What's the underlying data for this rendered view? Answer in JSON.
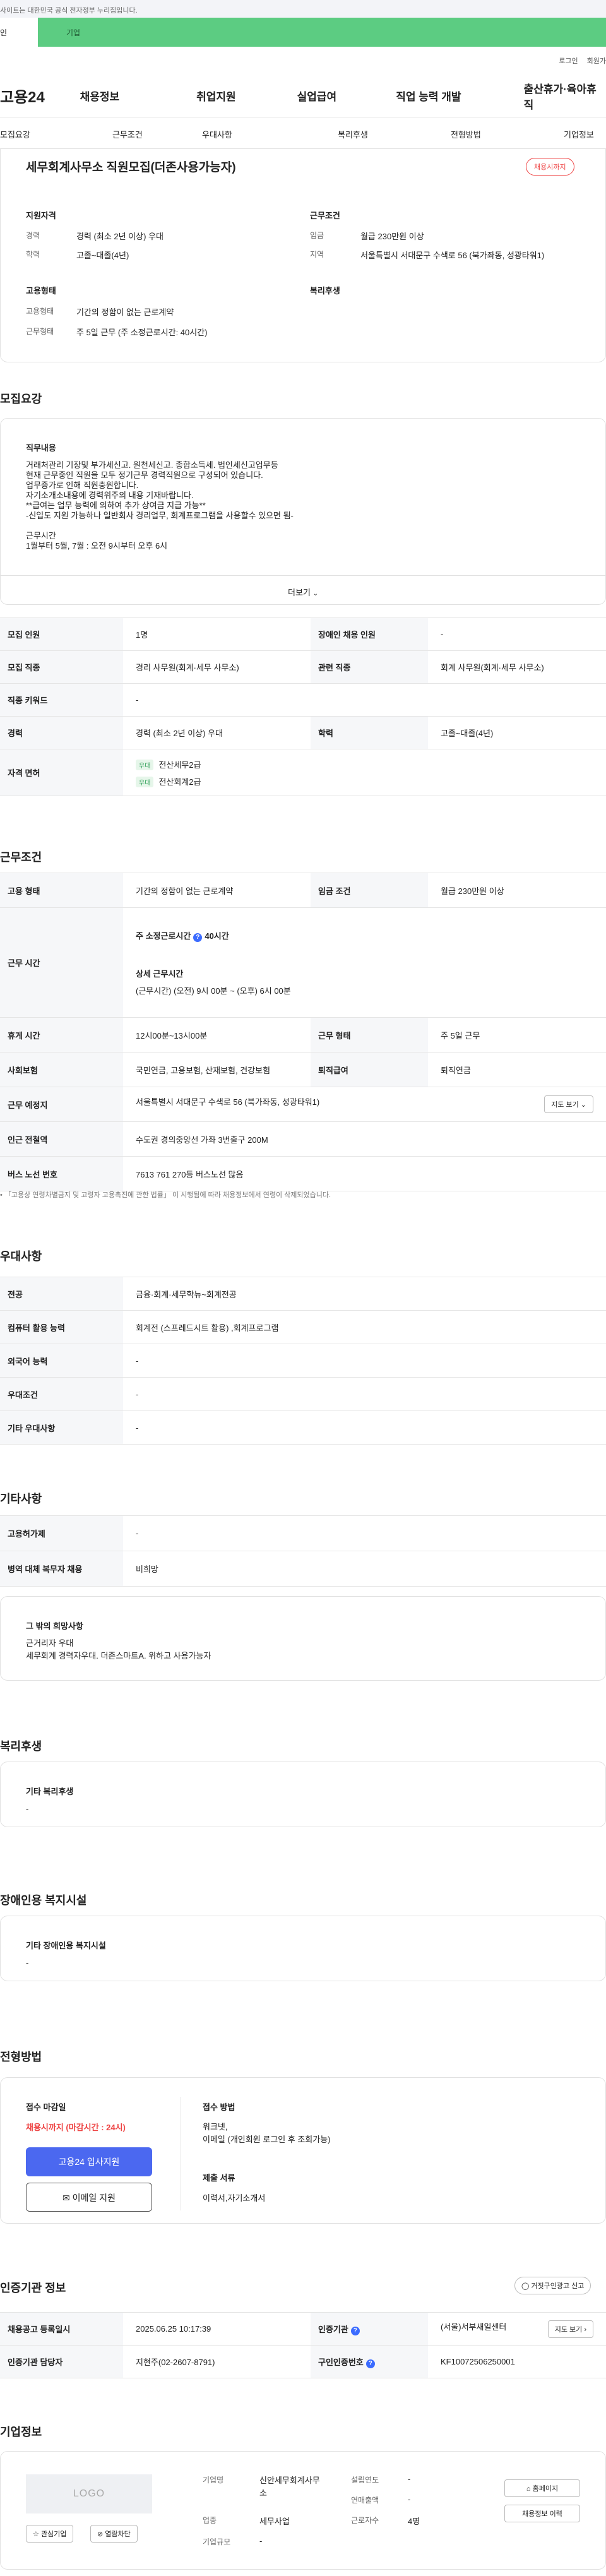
{
  "topbar": {
    "notice": "사이트는 대한민국 공식 전자정부 누리집입니다."
  },
  "tabs": {
    "person": "인",
    "business": "기업"
  },
  "utility": {
    "login": "로그인",
    "signup": "회원가"
  },
  "gnb": {
    "logo": "고용24",
    "items": [
      "채용정보",
      "취업지원",
      "실업급여",
      "직업 능력 개발",
      "출산휴가·육아휴직"
    ]
  },
  "subnav": [
    "모집요강",
    "근무조건",
    "우대사항",
    "복리후생",
    "전형방법",
    "기업정보"
  ],
  "summary": {
    "title": "세무회계사무소 직원모집(더존사용가능자)",
    "badge": "채용시까지",
    "qual_head": "지원자격",
    "career_label": "경력",
    "career_val": "경력 (최소 2년 이상) 우대",
    "edu_label": "학력",
    "edu_val": "고졸~대졸(4년)",
    "cond_head": "근무조건",
    "wage_label": "임금",
    "wage_val": "월급 230만원 이상",
    "region_label": "지역",
    "region_val": "서울특별시 서대문구 수색로 56 (북가좌동, 성광타워1)",
    "emp_head": "고용형태",
    "emp_label": "고용형태",
    "emp_val": "기간의 정함이 없는 근로계약",
    "work_label": "근무형태",
    "work_val": "주 5일 근무 (주 소정근로시간: 40시간)",
    "welfare_head": "복리후생"
  },
  "recruit": {
    "title": "모집요강",
    "job_head": "직무내용",
    "job_lines": [
      "거래처관리 기장및 부가세신고. 원천세신고. 종합소득세. 법인세신고업무등",
      "현재 근무중인 직원을 모두 정기근무 경력직원으로 구성되어 있습니다.",
      "업무증가로 인해 직원충원합니다.",
      "자기소개소내용에 경력위주의 내용 기재바랍니다.",
      "**급여는 업무 능력에 의하여 추가 상여금 지급 가능**",
      "-신입도 지원 가능하나 일반회사 경리업무, 회계프로그램을 사용할수 있으면 됨-",
      "",
      "근무시간",
      "1월부터 5월, 7월 : 오전 9시부터 오후 6시"
    ],
    "more": "더보기",
    "rows": {
      "headcount_label": "모집 인원",
      "headcount_val": "1명",
      "disabled_label": "장애인 채용 인원",
      "disabled_val": "-",
      "job_label": "모집 직종",
      "job_val": "경리 사무원(회계·세무 사무소)",
      "related_label": "관련 직종",
      "related_val": "회계 사무원(회계·세무 사무소)",
      "keyword_label": "직종 키워드",
      "keyword_val": "-",
      "career_label": "경력",
      "career_val": "경력 (최소 2년 이상) 우대",
      "edu_label": "학력",
      "edu_val": "고졸~대졸(4년)",
      "license_label": "자격 면허",
      "licenses": [
        {
          "tag": "우대",
          "name": "전산세무2급"
        },
        {
          "tag": "우대",
          "name": "전산회계2급"
        }
      ]
    }
  },
  "conditions": {
    "title": "근무조건",
    "emp_label": "고용 형태",
    "emp_val": "기간의 정함이 없는 근로계약",
    "wage_label": "임금 조건",
    "wage_val": "월급 230만원 이상",
    "time_label": "근무 시간",
    "weekly": "주 소정근로시간",
    "weekly_hours": "40시간",
    "detail_head": "상세 근무시간",
    "detail_val": "(근무시간) (오전) 9시 00분 ~ (오후) 6시 00분",
    "break_label": "휴게 시간",
    "break_val": "12시00분~13시00분",
    "form_label": "근무 형태",
    "form_val": "주 5일 근무",
    "insurance_label": "사회보험",
    "insurance_val": "국민연금, 고용보험, 산재보험, 건강보험",
    "retire_label": "퇴직급여",
    "retire_val": "퇴직연금",
    "place_label": "근무 예정지",
    "place_val": "서울특별시 서대문구 수색로 56 (북가좌동, 성광타워1)",
    "map_btn": "지도 보기",
    "subway_label": "인근 전철역",
    "subway_val": "수도권 경의중앙선 가좌 3번출구 200M",
    "bus_label": "버스 노선 번호",
    "bus_val": "7613 761 270등 버스노선 많음",
    "note": "「고용상 연령차별금지 및 고령자 고용촉진에 관한 법률」 이 시행됨에 따라 채용정보에서 연령이 삭제되었습니다."
  },
  "prefs": {
    "title": "우대사항",
    "major_label": "전공",
    "major_val": "금융·회계·세무학뉴~회계전공",
    "pc_label": "컴퓨터 활용 능력",
    "pc_val": "회계전 (스프레드시트 활용) ,회계프로그램",
    "lang_label": "외국어 능력",
    "lang_val": "-",
    "cond_label": "우대조건",
    "cond_val": "-",
    "etc_label": "기타 우대사항",
    "etc_val": "-"
  },
  "others": {
    "title": "기타사항",
    "foreign_label": "고용허가제",
    "foreign_val": "-",
    "military_label": "병역 대체 복무자 채용",
    "military_val": "비희망",
    "wish_head": "그 밖의 희망사항",
    "wish_lines": [
      "근거리자 우대",
      "세무회계 경력자우대. 더존스마트A. 위하고 사용가능자"
    ]
  },
  "welfare": {
    "title": "복리후생",
    "head": "기타 복리후생",
    "val": "-"
  },
  "disabled_fac": {
    "title": "장애인용 복지시설",
    "head": "기타 장애인용 복지시설",
    "val": "-"
  },
  "process": {
    "title": "전형방법",
    "deadline_head": "접수 마감일",
    "deadline_val": "채용시까지 (마감시간 : 24시)",
    "apply_btn": "고용24 입사지원",
    "email_btn": "이메일 지원",
    "method_head": "접수 방법",
    "method_lines": [
      "워크넷,",
      "이메일 (개인회원 로그인 후 조회가능)"
    ],
    "docs_head": "제출 서류",
    "docs_val": "이력서,자기소개서"
  },
  "agency": {
    "title": "인증기관 정보",
    "report_btn": "거짓구인광고 신고",
    "reg_label": "채용공고 등록일시",
    "reg_val": "2025.06.25 10:17:39",
    "org_label": "인증기관",
    "org_val": "(서울)서부새일센터",
    "map_btn": "지도 보기",
    "staff_label": "인증기관 담당자",
    "staff_val": "지현주(02-2607-8791)",
    "no_label": "구인인증번호",
    "no_val": "KF10072506250001"
  },
  "company": {
    "title": "기업정보",
    "logo_text": "LOGO",
    "fav_btn": "관심기업",
    "chat_btn": "열람차단",
    "name_label": "기업명",
    "name_lines": [
      "신안세무회계사무",
      "소"
    ],
    "industry_label": "업종",
    "industry_val": "세무사업",
    "scale_label": "기업규모",
    "scale_val": "-",
    "founded_label": "설립연도",
    "founded_val": "-",
    "sales_label": "연매출액",
    "sales_val": "-",
    "staff_label": "근로자수",
    "staff_val": "4명",
    "homepage_btn": "홈페이지",
    "history_btn": "채용정보 이력"
  },
  "colors": {
    "accent": "#4b68f0",
    "brand_green": "#5ccc82",
    "badge_red": "#e44444"
  }
}
